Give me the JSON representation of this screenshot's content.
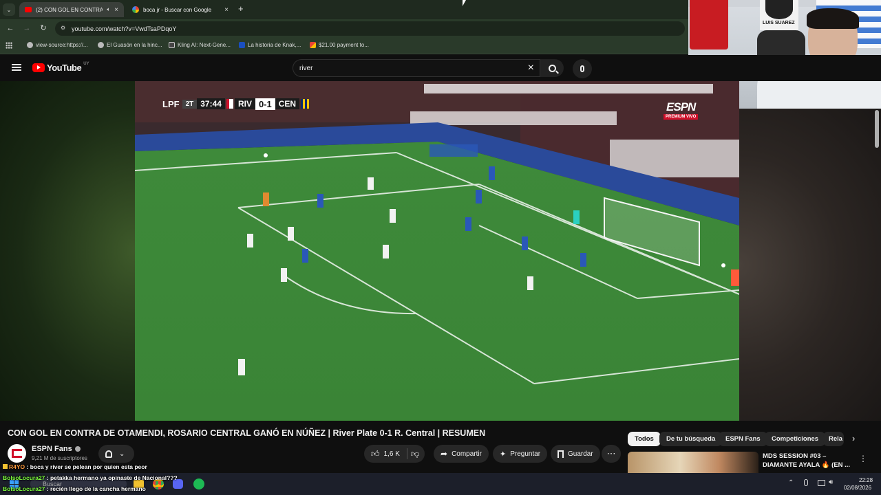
{
  "browser": {
    "tabs": [
      {
        "title": "(2) CON GOL EN CONTRA D",
        "favicon": "youtube-icon"
      },
      {
        "title": "boca jr - Buscar con Google",
        "favicon": "google-icon"
      }
    ],
    "url": "youtube.com/watch?v=VwdTsaPDqoY",
    "bookmarks": [
      {
        "label": "view-source:https://...",
        "icon": "globe-icon"
      },
      {
        "label": "El Guasón en la hinc...",
        "icon": "globe-icon"
      },
      {
        "label": "Kling AI: Next-Gene...",
        "icon": "kling-icon"
      },
      {
        "label": "La historia de Knak,...",
        "icon": "blog-icon"
      },
      {
        "label": "$21.00 payment to...",
        "icon": "gmail-icon"
      }
    ]
  },
  "youtube": {
    "logo_text": "YouTube",
    "region": "UY",
    "search_value": "river"
  },
  "video": {
    "scorebug": {
      "league": "LPF",
      "period": "2T",
      "clock": "37:44",
      "home": "RIV",
      "score": "0-1",
      "away": "CEN"
    },
    "broadcaster": "ESPN",
    "broadcaster_tag": "PREMIUM VIVO"
  },
  "details": {
    "title": "CON GOL EN CONTRA DE OTAMENDI, ROSARIO CENTRAL GANÓ EN NÚÑEZ | River Plate 0-1 R. Central | RESUMEN",
    "channel": "ESPN Fans",
    "subscribers": "9,21 M de suscriptores",
    "likes": "1,6 K",
    "share_label": "Compartir",
    "ask_label": "Preguntar",
    "save_label": "Guardar"
  },
  "chips": [
    {
      "label": "Todos",
      "selected": true
    },
    {
      "label": "De tu búsqueda",
      "selected": false
    },
    {
      "label": "ESPN Fans",
      "selected": false
    },
    {
      "label": "Competiciones",
      "selected": false
    },
    {
      "label": "Rela",
      "selected": false
    }
  ],
  "recommended": {
    "title_line1": "MDS SESSION #03 –",
    "title_line2": "DIAMANTE AYALA 🔥 (EN ..."
  },
  "chat": [
    {
      "user": "R4YO",
      "message": "boca y river se pelean por quien esta peor"
    },
    {
      "user": "BolsoLocura27",
      "message": "petakka hermano ya opinaste de Nacional???"
    },
    {
      "user": "BolsoLocura27",
      "message": "recién llego de la cancha hermano"
    }
  ],
  "taskbar": {
    "search_label": "Buscar",
    "time": "22:28",
    "date": "02/08/2026"
  },
  "webcam": {
    "poster_text": "LUIS SUAREZ"
  }
}
